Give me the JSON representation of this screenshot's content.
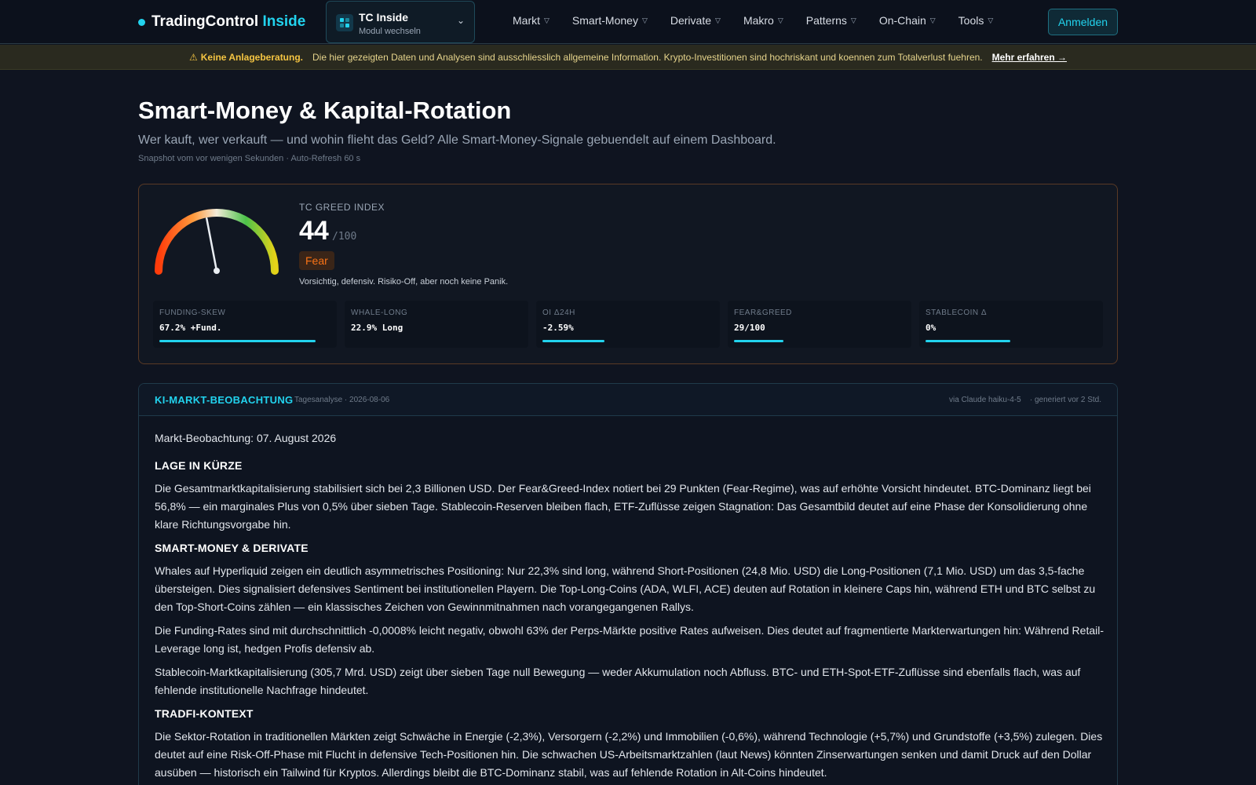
{
  "header": {
    "brand_main": "TradingControl",
    "brand_accent": "Inside",
    "module": {
      "title": "TC Inside",
      "subtitle": "Modul wechseln"
    },
    "nav": [
      "Markt",
      "Smart-Money",
      "Derivate",
      "Makro",
      "Patterns",
      "On-Chain",
      "Tools"
    ],
    "login_label": "Anmelden"
  },
  "banner": {
    "icon": "⚠",
    "strong": "Keine Anlageberatung.",
    "text": "Die hier gezeigten Daten und Analysen sind ausschliesslich allgemeine Information. Krypto-Investitionen sind hochriskant und koennen zum Totalverlust fuehren.",
    "link": "Mehr erfahren →"
  },
  "page": {
    "title": "Smart-Money & Kapital-Rotation",
    "subtitle": "Wer kauft, wer verkauft — und wohin flieht das Geld? Alle Smart-Money-Signale gebuendelt auf einem Dashboard.",
    "meta": "Snapshot vom vor wenigen Sekunden · Auto-Refresh 60 s"
  },
  "greed": {
    "label": "TC GREED INDEX",
    "value": "44",
    "value_num": 44,
    "max": "/100",
    "badge": "Fear",
    "description": "Vorsichtig, defensiv. Risiko-Off, aber noch keine Panik.",
    "metrics": [
      {
        "label": "FUNDING-SKEW",
        "value": "67.2% +Fund.",
        "level": 0.98
      },
      {
        "label": "WHALE-LONG",
        "value": "22.9% Long",
        "level": 0
      },
      {
        "label": "OI Δ24H",
        "value": "-2.59%",
        "level": 0.39
      },
      {
        "label": "FEAR&GREED",
        "value": "29/100",
        "level": 0.31
      },
      {
        "label": "STABLECOIN Δ",
        "value": "0%",
        "level": 0.53
      }
    ]
  },
  "ai": {
    "title": "KI-MARKT-BEOBACHTUNG",
    "date": "Tagesanalyse · 2026-08-06",
    "via": "via Claude haiku-4-5    · generiert vor 2 Std.",
    "intro": "Markt-Beobachtung: 07. August 2026",
    "sections": [
      {
        "heading": "LAGE IN KÜRZE",
        "paragraphs": [
          "Die Gesamtmarktkapitalisierung stabilisiert sich bei 2,3 Billionen USD. Der Fear&Greed-Index notiert bei 29 Punkten (Fear-Regime), was auf erhöhte Vorsicht hindeutet. BTC-Dominanz liegt bei 56,8% — ein marginales Plus von 0,5% über sieben Tage. Stablecoin-Reserven bleiben flach, ETF-Zuflüsse zeigen Stagnation: Das Gesamtbild deutet auf eine Phase der Konsolidierung ohne klare Richtungsvorgabe hin."
        ]
      },
      {
        "heading": "SMART-MONEY & DERIVATE",
        "paragraphs": [
          "Whales auf Hyperliquid zeigen ein deutlich asymmetrisches Positioning: Nur 22,3% sind long, während Short-Positionen (24,8 Mio. USD) die Long-Positionen (7,1 Mio. USD) um das 3,5-fache übersteigen. Dies signalisiert defensives Sentiment bei institutionellen Playern. Die Top-Long-Coins (ADA, WLFI, ACE) deuten auf Rotation in kleinere Caps hin, während ETH und BTC selbst zu den Top-Short-Coins zählen — ein klassisches Zeichen von Gewinnmitnahmen nach vorangegangenen Rallys.",
          "Die Funding-Rates sind mit durchschnittlich -0,0008% leicht negativ, obwohl 63% der Perps-Märkte positive Rates aufweisen. Dies deutet auf fragmentierte Markterwartungen hin: Während Retail-Leverage long ist, hedgen Profis defensiv ab.",
          "Stablecoin-Marktkapitalisierung (305,7 Mrd. USD) zeigt über sieben Tage null Bewegung — weder Akkumulation noch Abfluss. BTC- und ETH-Spot-ETF-Zuflüsse sind ebenfalls flach, was auf fehlende institutionelle Nachfrage hindeutet."
        ]
      },
      {
        "heading": "TRADFI-KONTEXT",
        "paragraphs": [
          "Die Sektor-Rotation in traditionellen Märkten zeigt Schwäche in Energie (-2,3%), Versorgern (-2,2%) und Immobilien (-0,6%), während Technologie (+5,7%) und Grundstoffe (+3,5%) zulegen. Dies deutet auf eine Risk-Off-Phase mit Flucht in defensive Tech-Positionen hin. Die schwachen US-Arbeitsmarktzahlen (laut News) könnten Zinserwartungen senken und damit Druck auf den Dollar ausüben — historisch ein Tailwind für Kryptos. Allerdings bleibt die BTC-Dominanz stabil, was auf fehlende Rotation in Alt-Coins hindeutet."
        ]
      }
    ]
  },
  "colors": {
    "accent": "#22d3ee",
    "fear": "#f97316",
    "warning": "#f5c542"
  }
}
